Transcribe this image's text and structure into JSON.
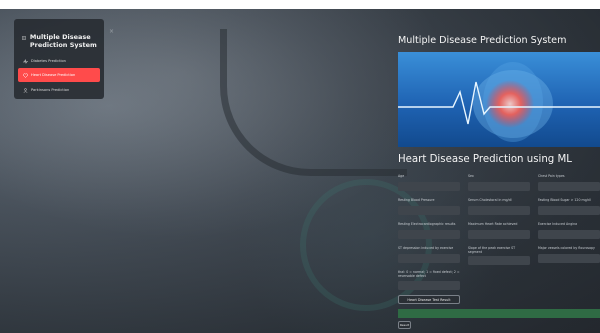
{
  "sidebar": {
    "title": "Multiple Disease Prediction System",
    "items": [
      {
        "label": "Diabetes Prediction",
        "icon": "activity-icon",
        "active": false
      },
      {
        "label": "Heart Disease Prediction",
        "icon": "heart-icon",
        "active": true
      },
      {
        "label": "Parkinsons Prediction",
        "icon": "person-icon",
        "active": false
      }
    ],
    "close_symbol": "×"
  },
  "main": {
    "title": "Multiple Disease Prediction System",
    "section_title": "Heart Disease Prediction using ML",
    "fields": [
      {
        "label": "Age"
      },
      {
        "label": "Sex"
      },
      {
        "label": "Chest Pain types"
      },
      {
        "label": "Resting Blood Pressure"
      },
      {
        "label": "Serum Cholestoral in mg/dl"
      },
      {
        "label": "Fasting Blood Sugar > 120 mg/dl"
      },
      {
        "label": "Resting Electrocardiographic results"
      },
      {
        "label": "Maximum Heart Rate achieved"
      },
      {
        "label": "Exercise Induced Angina"
      },
      {
        "label": "ST depression induced by exercise"
      },
      {
        "label": "Slope of the peak exercise ST segment"
      },
      {
        "label": "Major vessels colored by flourosopy"
      },
      {
        "label": "thal: 0 = normal; 1 = fixed defect; 2 = reversable defect"
      }
    ],
    "predict_button": "Heart Disease Test Result",
    "small_button": "Result"
  },
  "colors": {
    "accent": "#ff4b4b",
    "result_bar": "#2f6b44",
    "input_bg": "#3f454c"
  }
}
